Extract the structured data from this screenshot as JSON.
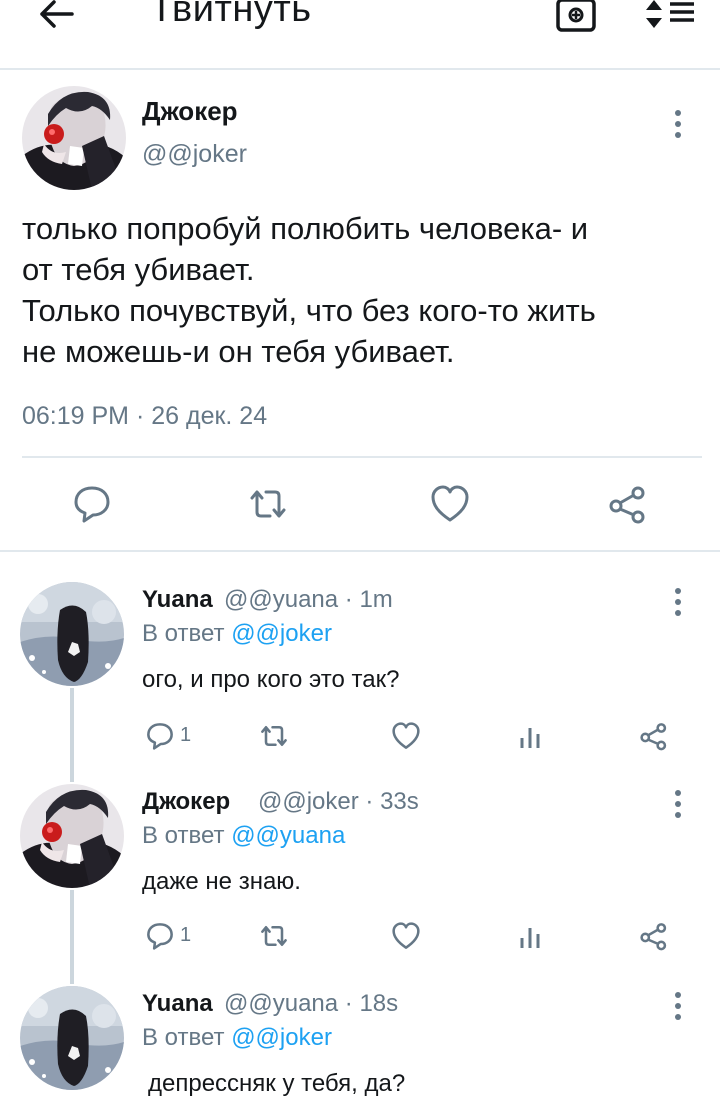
{
  "header": {
    "title": "Твитнуть",
    "back_icon": "arrow-left-icon",
    "camera_icon": "camera-icon",
    "sort_icon": "sort-icon"
  },
  "main_tweet": {
    "name": "Джокер",
    "handle": "@@joker",
    "text": "только попробуй полюбить человека- и\nот тебя убивает.\nТолько почувствуй, что без кого-то жить\nне можешь-и он тебя убивает.",
    "time": "06:19 PM · 26 дек. 24",
    "actions": [
      "reply-icon",
      "retweet-icon",
      "like-icon",
      "share-icon"
    ]
  },
  "replies": [
    {
      "name": "Yuana",
      "handle": "@@yuana",
      "time": "· 1m",
      "reply_prefix": "В ответ",
      "reply_to": "@@joker",
      "text": "ого, и про кого это так?",
      "reply_count": "1"
    },
    {
      "name": "Джокер",
      "handle": "@@joker",
      "time": "· 33s",
      "reply_prefix": "В ответ",
      "reply_to": "@@yuana",
      "text": "даже не знаю.",
      "reply_count": "1"
    },
    {
      "name": "Yuana",
      "handle": "@@yuana",
      "time": "· 18s",
      "reply_prefix": "В ответ",
      "reply_to": "@@joker",
      "text": "депрессняк у тебя, да?"
    }
  ],
  "colors": {
    "accent": "#1da1f2",
    "secondary_text": "#657786",
    "icon": "#657786",
    "divider": "#e1e8ed"
  }
}
